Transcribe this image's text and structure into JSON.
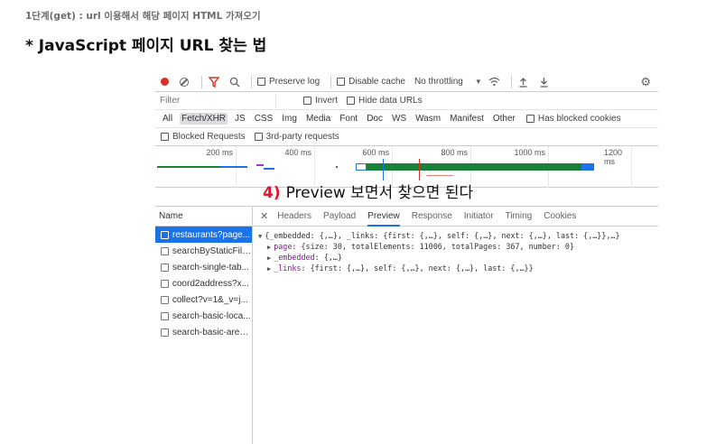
{
  "header": {
    "step_label": "1단계(get) : url 이용해서 해당 페이지 HTML 가져오기",
    "title": "* JavaScript 페이지 URL 찾는 법"
  },
  "toolbar": {
    "preserve_log": "Preserve log",
    "disable_cache": "Disable cache",
    "throttling": "No throttling"
  },
  "filter": {
    "placeholder": "Filter",
    "invert": "Invert",
    "hide_data_urls": "Hide data URLs"
  },
  "types": [
    "All",
    "Fetch/XHR",
    "JS",
    "CSS",
    "Img",
    "Media",
    "Font",
    "Doc",
    "WS",
    "Wasm",
    "Manifest",
    "Other"
  ],
  "types_active": "Fetch/XHR",
  "has_blocked_cookies": "Has blocked cookies",
  "blocked_requests": "Blocked Requests",
  "third_party": "3rd-party requests",
  "timeline": {
    "ticks": [
      "200 ms",
      "400 ms",
      "600 ms",
      "800 ms",
      "1000 ms",
      "1200 ms"
    ]
  },
  "annotation": {
    "number": "4)",
    "text": "Preview 보면서 찾으면 된다"
  },
  "name_column": {
    "header": "Name",
    "requests": [
      "restaurants?page...",
      "searchByStaticFilter",
      "search-single-tab...",
      "coord2address?x...",
      "collect?v=1&_v=j...",
      "search-basic-loca...",
      "search-basic-area..."
    ]
  },
  "detail_tabs": [
    "Headers",
    "Payload",
    "Preview",
    "Response",
    "Initiator",
    "Timing",
    "Cookies"
  ],
  "active_tab": "Preview",
  "preview": {
    "line1": "{_embedded: {,…}, _links: {first: {,…}, self: {,…}, next: {,…}, last: {,…}},…}",
    "page_key": "page",
    "page_val": "{size: 30, totalElements: 11006, totalPages: 367, number: 0}",
    "embedded_key": "_embedded",
    "embedded_val": "{,…}",
    "links_key": "_links",
    "links_val": "{first: {,…}, self: {,…}, next: {,…}, last: {,…}}"
  },
  "icons": {
    "record": "record-icon",
    "clear": "clear-icon",
    "filter": "filter-icon",
    "search": "search-icon",
    "wifi": "network-conditions-icon",
    "upload": "upload-icon",
    "download": "download-icon",
    "settings": "gear-icon"
  },
  "colors": {
    "accent": "#1a73e8",
    "record": "#d93025",
    "annotation_number": "#e8112d",
    "json_key": "#881391"
  }
}
